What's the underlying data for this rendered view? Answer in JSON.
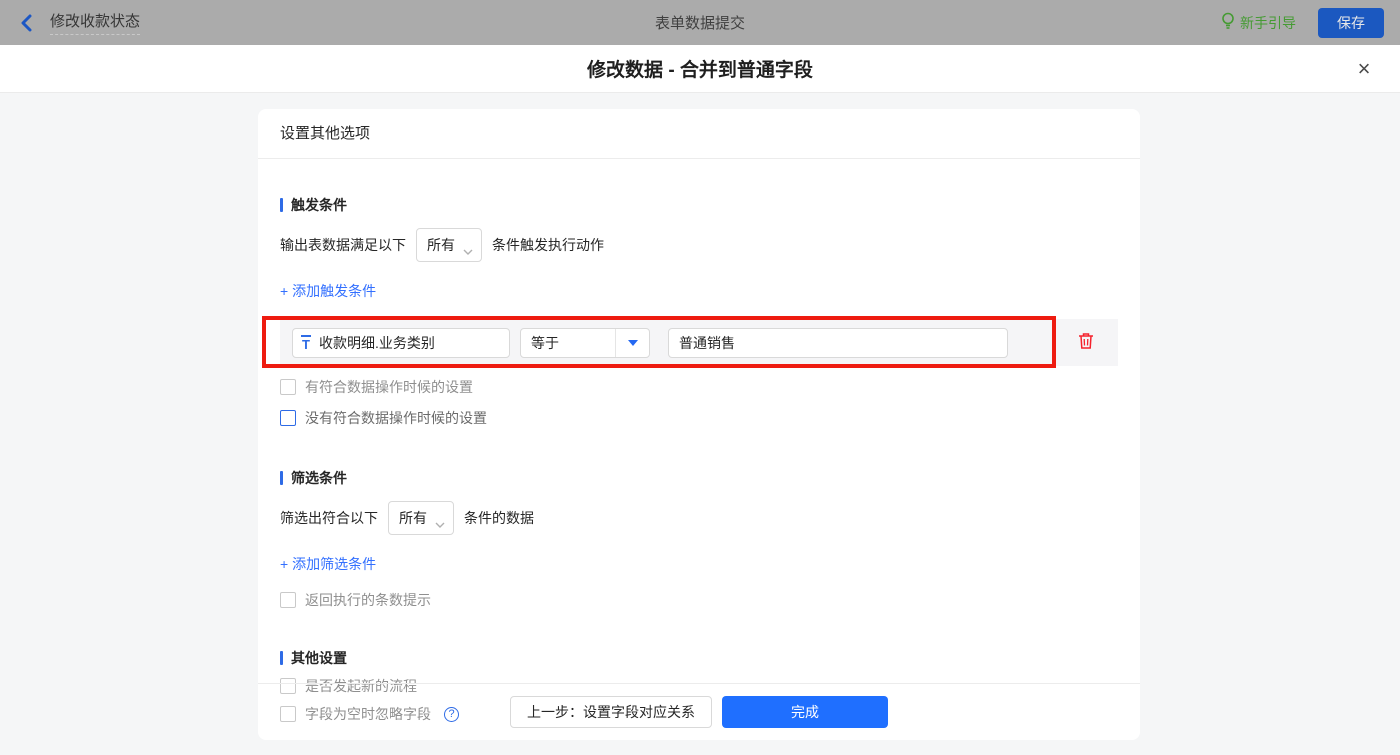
{
  "topbar": {
    "back_label": "修改收款状态",
    "center_title": "表单数据提交",
    "guide_label": "新手引导",
    "save_label": "保存"
  },
  "modal": {
    "title": "修改数据 - 合并到普通字段",
    "close_glyph": "×"
  },
  "card": {
    "header": "设置其他选项",
    "trigger_section": {
      "title": "触发条件",
      "sentence_prefix": "输出表数据满足以下",
      "match_select_value": "所有",
      "sentence_suffix": "条件触发执行动作",
      "add_link": "+ 添加触发条件",
      "condition": {
        "field_type_glyph": "T",
        "field": "收款明细.业务类别",
        "operator": "等于",
        "value": "普通销售"
      },
      "checkbox_has_match": "有符合数据操作时候的设置",
      "checkbox_no_match": "没有符合数据操作时候的设置"
    },
    "filter_section": {
      "title": "筛选条件",
      "sentence_prefix": "筛选出符合以下",
      "match_select_value": "所有",
      "sentence_suffix": "条件的数据",
      "add_link": "+ 添加筛选条件",
      "checkbox_count_tip": "返回执行的条数提示"
    },
    "other_section": {
      "title": "其他设置",
      "checkbox_new_flow": "是否发起新的流程",
      "checkbox_ignore_empty": "字段为空时忽略字段",
      "help_glyph": "?"
    },
    "footer": {
      "prev_label": "上一步：设置字段对应关系",
      "done_label": "完成"
    }
  },
  "colors": {
    "accent_blue": "#2e6be6",
    "link_blue": "#3370ff",
    "done_button_blue": "#1f6fff",
    "save_button_blue": "#1b58c0",
    "guide_green": "#459b33",
    "annotation_red": "#ee1b10",
    "trash_red": "#f5222d",
    "topbar_gray": "#ababab",
    "page_bg": "#f5f6f7",
    "row_bg": "#f5f5f7"
  }
}
